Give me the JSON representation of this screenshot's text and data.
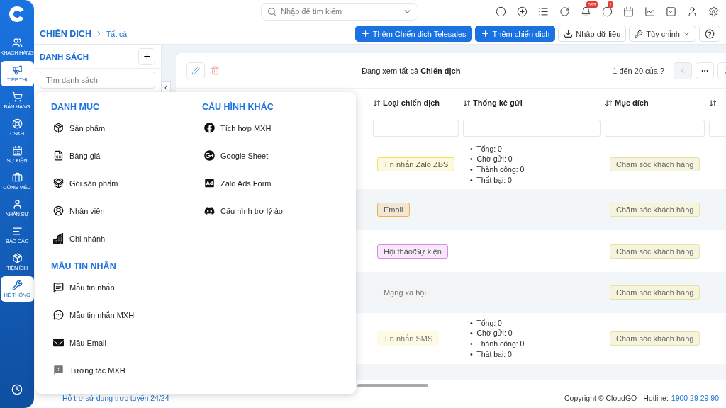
{
  "sidebar": {
    "items": [
      {
        "label": "KHÁCH HÀNG",
        "selected": false
      },
      {
        "label": "TIẾP THỊ",
        "selected": true
      },
      {
        "label": "BÁN HÀNG",
        "selected": false
      },
      {
        "label": "CSKH",
        "selected": false
      },
      {
        "label": "SỰ KIỆN",
        "selected": false
      },
      {
        "label": "CÔNG VIỆC",
        "selected": false
      },
      {
        "label": "NHÂN SỰ",
        "selected": false
      },
      {
        "label": "BÁO CÁO",
        "selected": false
      },
      {
        "label": "TIỆN ÍCH",
        "selected": false
      },
      {
        "label": "HỆ THỐNG",
        "selected": true
      }
    ]
  },
  "topbar": {
    "search": {
      "placeholder": "Nhập để tìm kiếm"
    },
    "badges": {
      "notifications": "693",
      "messages": "1"
    }
  },
  "breadcrumb": {
    "title": "CHIẾN DỊCH",
    "current": "Tất cả"
  },
  "actions": [
    {
      "kind": "primary",
      "label": "Thêm Chiến dịch Telesales"
    },
    {
      "kind": "primary",
      "label": "Thêm chiến dịch"
    },
    {
      "kind": "import",
      "label": "Nhập dữ liệu"
    },
    {
      "kind": "dropdown",
      "label": "Tùy chỉnh"
    },
    {
      "kind": "help"
    }
  ],
  "list_panel": {
    "title": "DANH SÁCH",
    "search_placeholder": "Tìm danh sách"
  },
  "toolbar": {
    "viewing": "Đang xem tất cả **Chiến dịch**",
    "pagination": "1 đến 20 của ?"
  },
  "table": {
    "columns": [
      "Loại chiến dịch",
      "Thống kê gửi",
      "Mục đích"
    ],
    "rows": [
      {
        "type": {
          "label": "Tin nhắn Zalo ZBS",
          "kind": "outlined",
          "color": "#f3e15a"
        },
        "stats": [
          "•  Tổng: 0",
          "•  Chờ gửi: 0",
          "•  Thành công: 0",
          "•  Thất bại: 0"
        ],
        "purpose": "Chăm sóc khách hàng"
      },
      {
        "type": {
          "label": "Email",
          "kind": "outlined",
          "color": "#eeb14a"
        },
        "purpose": "Chăm sóc khách hàng"
      },
      {
        "type": {
          "label": "Hội thảo/Sự kiện",
          "kind": "outlined",
          "color": "#d98ae6"
        },
        "purpose": "Chăm sóc khách hàng"
      },
      {
        "type": {
          "label": "Mạng xã hội",
          "kind": "plain",
          "color": "#f4f4f4"
        },
        "purpose": "Chăm sóc khách hàng"
      },
      {
        "type": {
          "label": "Tin nhắn SMS",
          "kind": "plain",
          "color": "#fdfbe4"
        },
        "stats": [
          "•  Tổng: 0",
          "•  Chờ gửi: 0",
          "•  Thành công: 0",
          "•  Thất bại: 0"
        ],
        "purpose": "Chăm sóc khách hàng"
      }
    ]
  },
  "menu": {
    "columns": [
      {
        "sections": [
          {
            "title": "DANH MỤC",
            "items": [
              "Sản phẩm",
              "Bảng giá",
              "Gói sản phẩm",
              "Nhân viên",
              "Chi nhánh"
            ]
          },
          {
            "title": "MẪU TIN NHẮN",
            "items": [
              "Mẫu tin nhắn",
              "Mẫu tin nhắn MXH",
              "Mẫu Email",
              "Tương tác MXH"
            ]
          }
        ]
      },
      {
        "sections": [
          {
            "title": "CẤU HÌNH KHÁC",
            "items": [
              "Tích hợp MXH",
              "Google Sheet",
              "Zalo Ads Form",
              "Cấu hình trợ lý ảo"
            ]
          }
        ]
      }
    ]
  },
  "footer": {
    "support": "Hỗ trợ sử dụng trực tuyến 24/24",
    "copyright": "Copyright © CloudGO",
    "hotline_label": "Hotline:",
    "hotline": "1900 29 29 90"
  }
}
